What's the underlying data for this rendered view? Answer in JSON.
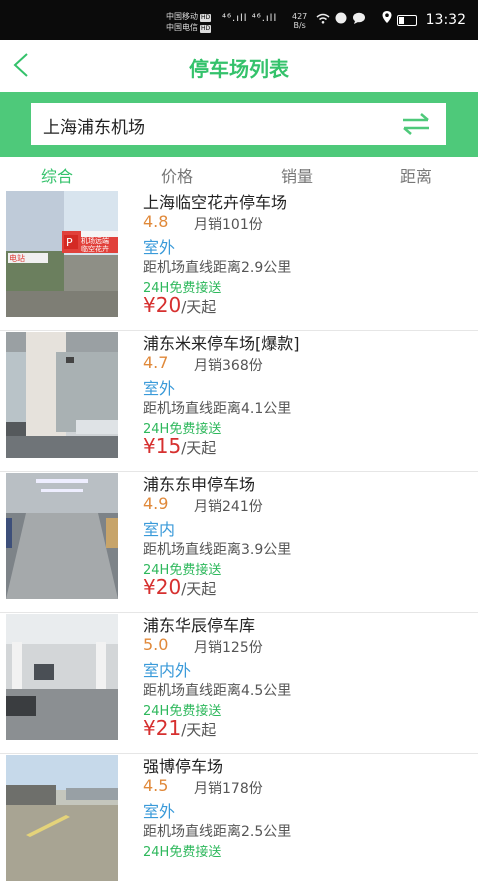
{
  "status_bar": {
    "carrier1": "中国移动",
    "carrier2": "中国电信",
    "hd": "HD",
    "signal": "⁴⁶.ıll ⁴⁶.ıll",
    "speed_value": "427",
    "speed_unit": "B/s",
    "time": "13:32"
  },
  "header": {
    "title": "停车场列表"
  },
  "search": {
    "value": "上海浦东机场"
  },
  "tabs": [
    {
      "label": "综合",
      "active": true
    },
    {
      "label": "价格"
    },
    {
      "label": "销量"
    },
    {
      "label": "距离"
    }
  ],
  "lots": [
    {
      "name": "上海临空花卉停车场",
      "rating": "4.8",
      "sales": "月销101份",
      "type": "室外",
      "distance": "距机场直线距离2.9公里",
      "shuttle": "24H免费接送",
      "price": "¥20",
      "unit": "/天起"
    },
    {
      "name": "浦东米来停车场[爆款]",
      "rating": "4.7",
      "sales": "月销368份",
      "type": "室外",
      "distance": "距机场直线距离4.1公里",
      "shuttle": "24H免费接送",
      "price": "¥15",
      "unit": "/天起"
    },
    {
      "name": "浦东东申停车场",
      "rating": "4.9",
      "sales": "月销241份",
      "type": "室内",
      "distance": "距机场直线距离3.9公里",
      "shuttle": "24H免费接送",
      "price": "¥20",
      "unit": "/天起"
    },
    {
      "name": "浦东华辰停车库",
      "rating": "5.0",
      "sales": "月销125份",
      "type": "室内外",
      "distance": "距机场直线距离4.5公里",
      "shuttle": "24H免费接送",
      "price": "¥21",
      "unit": "/天起"
    },
    {
      "name": "强博停车场",
      "rating": "4.5",
      "sales": "月销178份",
      "type": "室外",
      "distance": "距机场直线距离2.5公里",
      "shuttle": "24H免费接送",
      "price": "",
      "unit": ""
    }
  ],
  "thumb_signs": {
    "sign1": "机场远端",
    "sign2": "临空花卉",
    "sign3": "电站"
  },
  "colors": {
    "accent": "#34c26b",
    "search_bar": "#4ec97a",
    "rating": "#e0893a",
    "type": "#3a9ad9",
    "price": "#d6302f"
  }
}
